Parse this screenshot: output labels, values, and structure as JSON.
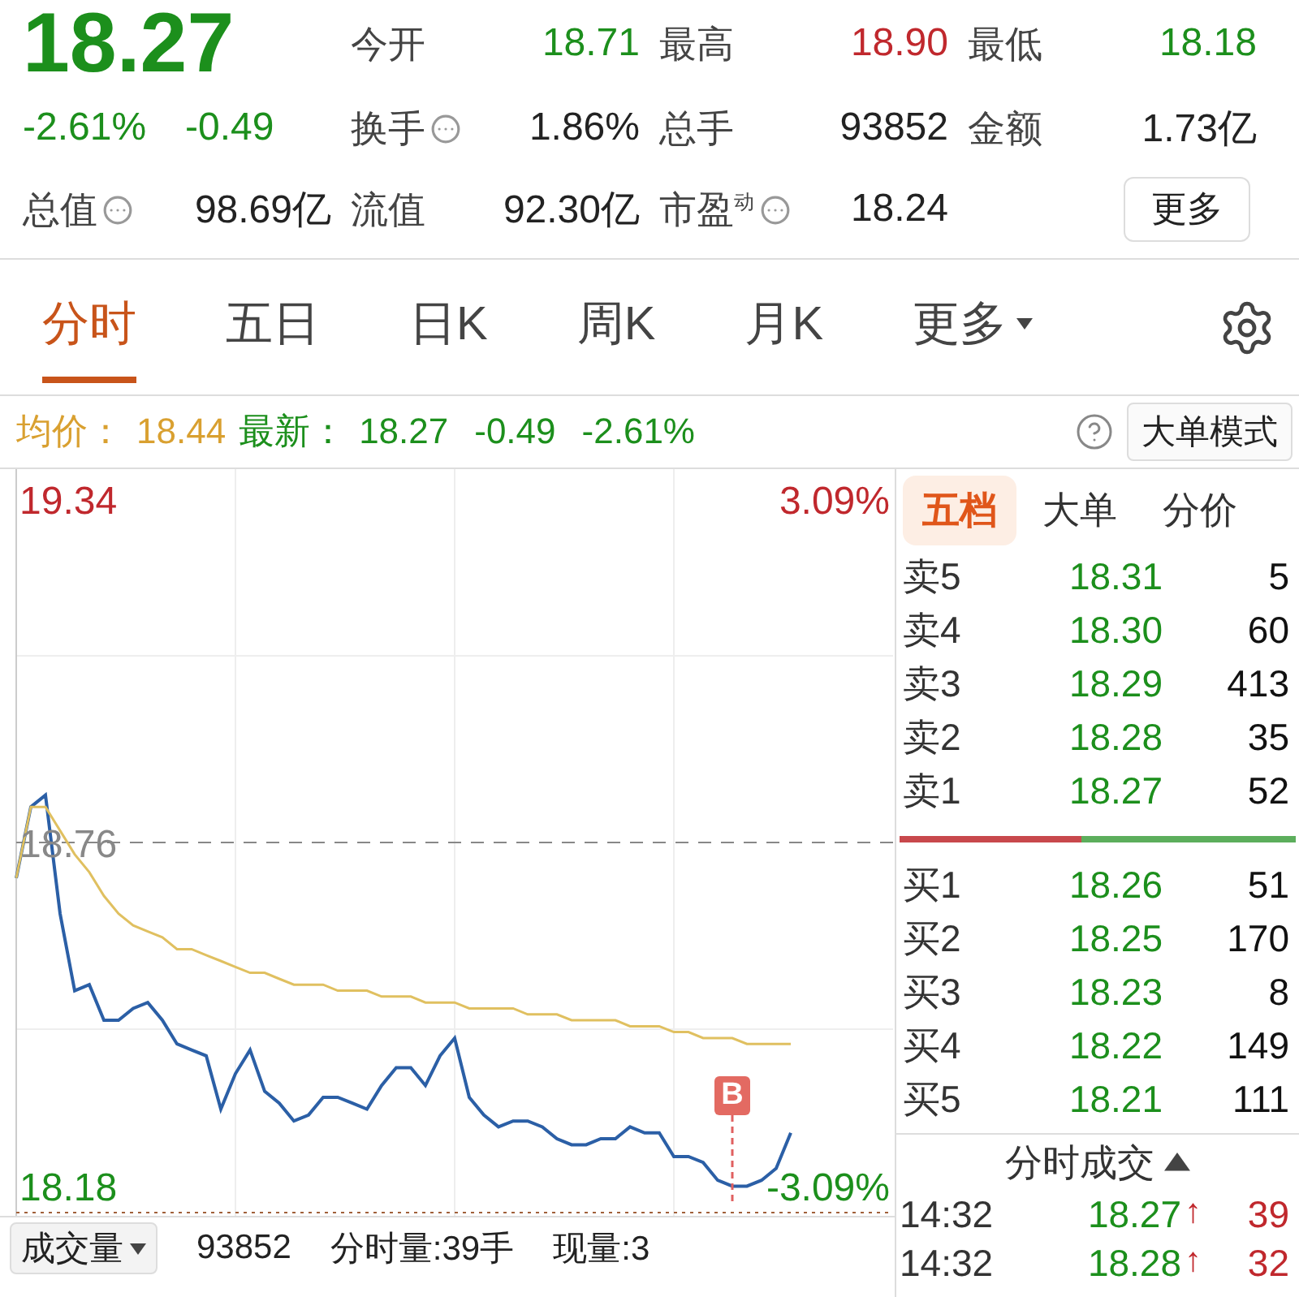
{
  "quote": {
    "price": "18.27",
    "change_pct": "-2.61%",
    "change": "-0.49",
    "color": "#1c8f1c"
  },
  "stats": [
    {
      "label": "今开",
      "value": "18.71",
      "color": "#1c8f1c"
    },
    {
      "label": "最高",
      "value": "18.90",
      "color": "#c0282d"
    },
    {
      "label": "最低",
      "value": "18.18",
      "color": "#1c8f1c"
    },
    {
      "label": "换手",
      "info": true,
      "value": "1.86%",
      "color": "#222222"
    },
    {
      "label": "总手",
      "value": "93852",
      "color": "#222222"
    },
    {
      "label": "金额",
      "value": "1.73亿",
      "color": "#222222"
    },
    {
      "label": "总值",
      "info": true,
      "value": "98.69亿",
      "color": "#222222"
    },
    {
      "label": "流值",
      "value": "92.30亿",
      "color": "#222222"
    },
    {
      "label": "市盈$^{动}$",
      "info": true,
      "value": "18.24",
      "color": "#222222"
    }
  ],
  "more_button": "更多",
  "tabs": [
    {
      "label": "分时",
      "selected": true
    },
    {
      "label": "五日",
      "selected": false
    },
    {
      "label": "日K",
      "selected": false
    },
    {
      "label": "周K",
      "selected": false
    },
    {
      "label": "月K",
      "selected": false
    },
    {
      "label": "更多",
      "selected": false,
      "dropdown": true
    }
  ],
  "info_line": {
    "avg_label": "均价：",
    "avg_value": "18.44",
    "latest_label": "最新：",
    "latest_price": "18.27",
    "latest_change": "-0.49",
    "latest_change_pct": "-2.61%",
    "mode_button": "大单模式"
  },
  "chart": {
    "pct_high": "3.09%",
    "pct_low": "-3.09%",
    "marker": "B",
    "chart_data": {
      "type": "line",
      "ylim": [
        18.13,
        19.39
      ],
      "grid": true,
      "ref_lines": [
        {
          "axis": "y",
          "value": 18.76
        }
      ],
      "yticks": [
        {
          "value": 19.34,
          "label": "19.34"
        },
        {
          "value": 18.76,
          "label": "18.76"
        },
        {
          "value": 18.18,
          "label": "18.18"
        }
      ],
      "categories": [
        null,
        null,
        null,
        null,
        null,
        null,
        null,
        null,
        null,
        null,
        null,
        null,
        null,
        null,
        null,
        null,
        null,
        null,
        null,
        null,
        null,
        null,
        null,
        null,
        null,
        null,
        null,
        null,
        null,
        null,
        null,
        null,
        null,
        null,
        null,
        null,
        null,
        null,
        null,
        null,
        null,
        null,
        null,
        null,
        null,
        null,
        null,
        null,
        null,
        null,
        null,
        null,
        null,
        null,
        null,
        null,
        null,
        null,
        null,
        null,
        null
      ],
      "series": [
        {
          "color": "#2b5fa6",
          "values": [
            18.7,
            18.82,
            18.84,
            18.64,
            18.51,
            18.52,
            18.46,
            18.46,
            18.48,
            18.49,
            18.46,
            18.42,
            18.41,
            18.4,
            18.31,
            18.37,
            18.41,
            18.34,
            18.32,
            18.29,
            18.3,
            18.33,
            18.33,
            18.32,
            18.31,
            18.35,
            18.38,
            18.38,
            18.35,
            18.4,
            18.43,
            18.33,
            18.3,
            18.28,
            18.29,
            18.29,
            18.28,
            18.26,
            18.25,
            18.25,
            18.26,
            18.26,
            18.28,
            18.27,
            18.27,
            18.23,
            18.23,
            18.22,
            18.19,
            18.18,
            18.18,
            18.19,
            18.21,
            18.27,
            null,
            null,
            null,
            null,
            null,
            null,
            null
          ]
        },
        {
          "color": "#e0c060",
          "values": [
            18.7,
            18.82,
            18.82,
            18.78,
            18.74,
            18.71,
            18.67,
            18.64,
            18.62,
            18.61,
            18.6,
            18.58,
            18.58,
            18.57,
            18.56,
            18.55,
            18.54,
            18.54,
            18.53,
            18.52,
            18.52,
            18.52,
            18.51,
            18.51,
            18.51,
            18.5,
            18.5,
            18.5,
            18.49,
            18.49,
            18.49,
            18.48,
            18.48,
            18.48,
            18.48,
            18.47,
            18.47,
            18.47,
            18.46,
            18.46,
            18.46,
            18.46,
            18.45,
            18.45,
            18.45,
            18.44,
            18.44,
            18.43,
            18.43,
            18.43,
            18.42,
            18.42,
            18.42,
            18.42,
            null,
            null,
            null,
            null,
            null,
            null,
            null
          ]
        }
      ]
    }
  },
  "book_tabs": [
    {
      "label": "五档",
      "selected": true
    },
    {
      "label": "大单",
      "selected": false
    },
    {
      "label": "分价",
      "selected": false
    }
  ],
  "asks": [
    {
      "label": "卖5",
      "price": "18.31",
      "volume": "5"
    },
    {
      "label": "卖4",
      "price": "18.30",
      "volume": "60"
    },
    {
      "label": "卖3",
      "price": "18.29",
      "volume": "413"
    },
    {
      "label": "卖2",
      "price": "18.28",
      "volume": "35"
    },
    {
      "label": "卖1",
      "price": "18.27",
      "volume": "52"
    }
  ],
  "ratio_bar": {
    "level": 0.46
  },
  "bids": [
    {
      "label": "买1",
      "price": "18.26",
      "volume": "51"
    },
    {
      "label": "买2",
      "price": "18.25",
      "volume": "170"
    },
    {
      "label": "买3",
      "price": "18.23",
      "volume": "8"
    },
    {
      "label": "买4",
      "price": "18.22",
      "volume": "149"
    },
    {
      "label": "买5",
      "price": "18.21",
      "volume": "111"
    }
  ],
  "trades_title": "分时成交",
  "trades": [
    {
      "time": "14:32",
      "price": "18.27",
      "arrow": "↑",
      "volume": "39"
    },
    {
      "time": "14:32",
      "price": "18.28",
      "arrow": "↑",
      "volume": "32"
    }
  ],
  "volume_bar": {
    "label": "成交量",
    "value": "93852",
    "minute_volume": "分时量:39手",
    "current_volume": "现量:3"
  }
}
